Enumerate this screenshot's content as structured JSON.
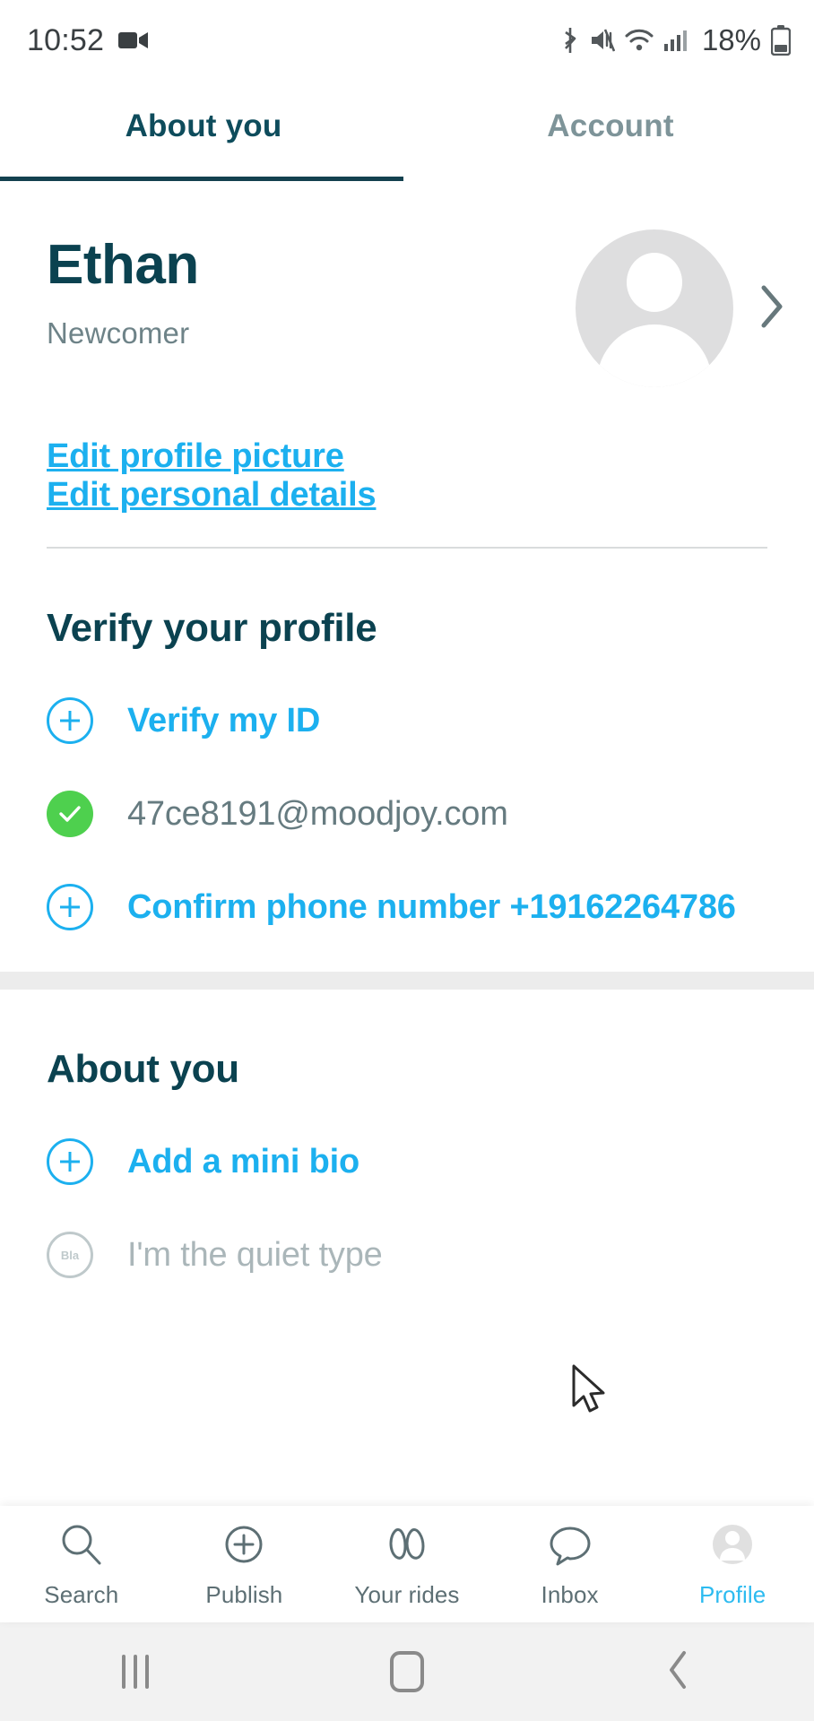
{
  "status_bar": {
    "time": "10:52",
    "battery_percent": "18%",
    "icons": [
      "video-camera-icon",
      "bluetooth-icon",
      "mute-icon",
      "wifi-icon",
      "cellular-signal-icon",
      "battery-icon"
    ]
  },
  "tabs": [
    {
      "label": "About you",
      "active": true
    },
    {
      "label": "Account",
      "active": false
    }
  ],
  "profile": {
    "name": "Ethan",
    "status": "Newcomer",
    "avatar_alt": "default-avatar",
    "chevron": "›"
  },
  "edit_links": [
    {
      "label": "Edit profile picture"
    },
    {
      "label": "Edit personal details"
    }
  ],
  "verify_section": {
    "title": "Verify your profile",
    "items": [
      {
        "label": "Verify my ID",
        "icon": "plus-circle-icon",
        "state": "pending"
      },
      {
        "label": "47ce8191@moodjoy.com",
        "icon": "check-circle-icon",
        "state": "verified"
      },
      {
        "label": "Confirm phone number +19162264786",
        "icon": "plus-circle-icon",
        "state": "pending"
      }
    ]
  },
  "about_section": {
    "title": "About you",
    "items": [
      {
        "label": "Add a mini bio",
        "icon": "plus-circle-icon"
      },
      {
        "label": "I'm the quiet type",
        "icon": "bio-circle-icon",
        "icon_text": "Bla"
      }
    ]
  },
  "bottom_nav": [
    {
      "label": "Search",
      "icon": "search-icon",
      "active": false
    },
    {
      "label": "Publish",
      "icon": "plus-circle-icon",
      "active": false
    },
    {
      "label": "Your rides",
      "icon": "rides-icon",
      "active": false
    },
    {
      "label": "Inbox",
      "icon": "chat-bubble-icon",
      "active": false
    },
    {
      "label": "Profile",
      "icon": "person-icon",
      "active": true
    }
  ],
  "android_nav": [
    {
      "name": "recents-button",
      "glyph": "|||"
    },
    {
      "name": "home-button",
      "glyph": "▢"
    },
    {
      "name": "back-button",
      "glyph": "‹"
    }
  ],
  "colors": {
    "accent_blue": "#1cb0ef",
    "dark_teal": "#0b4250",
    "verified_green": "#4ed04e",
    "muted_grey": "#6e8388"
  }
}
